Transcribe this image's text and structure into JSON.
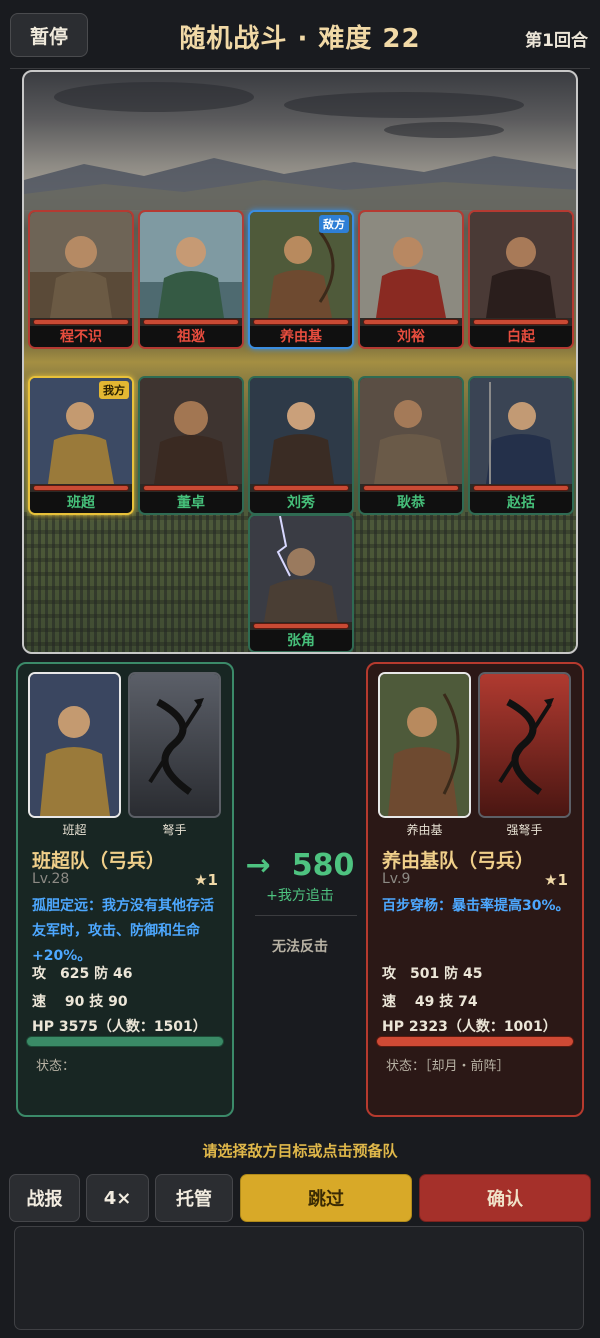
{
  "header": {
    "pause_label": "暂停",
    "title": "随机战斗 · 难度 22",
    "round": "第1回合"
  },
  "battlefield": {
    "enemy_row": [
      {
        "name": "程不识",
        "tag": ""
      },
      {
        "name": "祖逖",
        "tag": ""
      },
      {
        "name": "养由基",
        "tag": "敌方"
      },
      {
        "name": "刘裕",
        "tag": ""
      },
      {
        "name": "白起",
        "tag": ""
      }
    ],
    "ally_row": [
      {
        "name": "班超",
        "tag": "我方"
      },
      {
        "name": "董卓",
        "tag": ""
      },
      {
        "name": "刘秀",
        "tag": ""
      },
      {
        "name": "耿恭",
        "tag": ""
      },
      {
        "name": "赵括",
        "tag": ""
      }
    ],
    "reserve": {
      "name": "张角"
    }
  },
  "ally_panel": {
    "hero_label": "班超",
    "unit_label": "弩手",
    "squad": "班超队（弓兵）",
    "level": "Lv.28",
    "stars": "★1",
    "skill": "孤胆定远：我方没有其他存活友军时，攻击、防御和生命+20%。",
    "atk_def": "攻　625  防 46",
    "spd_tec": "速　 90  技 90",
    "hp": "HP 3575（人数：1501）",
    "hp_fraction": 1.0,
    "status": "状态："
  },
  "enemy_panel": {
    "hero_label": "养由基",
    "unit_label": "强弩手",
    "squad": "养由基队（弓兵）",
    "level": "Lv.9",
    "stars": "★1",
    "skill": "百步穿杨：暴击率提高30%。",
    "atk_def": "攻　501  防 45",
    "spd_tec": "速　 49  技 74",
    "hp": "HP 2323（人数：1001）",
    "hp_fraction": 1.0,
    "status": "状态：［却月・前阵］"
  },
  "preview": {
    "arrow": "→",
    "damage": "580",
    "note": "+我方追击",
    "counter": "无法反击"
  },
  "hint": "请选择敌方目标或点击预备队",
  "actions": {
    "report": "战报",
    "speed": "4×",
    "auto": "托管",
    "skip": "跳过",
    "confirm": "确认"
  },
  "colors": {
    "enemy_border": "#b53a32",
    "ally_border": "#2f6b53",
    "target_border": "#3a8de0",
    "selected_border": "#e8c13a",
    "damage_green": "#4ec380",
    "skill_blue": "#4da8ff"
  }
}
